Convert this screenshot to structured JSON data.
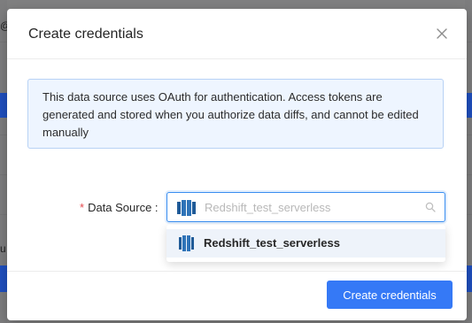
{
  "modal": {
    "title": "Create credentials",
    "info_message": "This data source uses OAuth for authentication. Access tokens are generated and stored when you authorize data diffs, and cannot be edited manually"
  },
  "form": {
    "required_marker": "*",
    "data_source_label": "Data Source :",
    "selected_value": "Redshift_test_serverless",
    "options": [
      {
        "label": "Redshift_test_serverless",
        "icon": "redshift-icon"
      }
    ]
  },
  "footer": {
    "create_button_label": "Create credentials"
  },
  "colors": {
    "primary": "#3579f6",
    "info_bg": "#eef5ff",
    "info_border": "#b8d2f5",
    "required": "#e5484d",
    "redshift": "#205b98"
  },
  "background_fragments": {
    "top_left": "@",
    "mid_left": "u"
  }
}
